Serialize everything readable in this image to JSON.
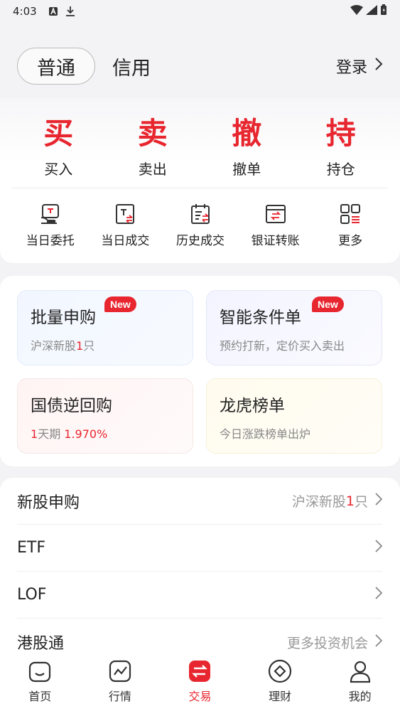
{
  "status_bar": {
    "time": "4:03"
  },
  "header": {
    "mode_active": "普通",
    "mode_other": "信用",
    "login_label": "登录"
  },
  "main_actions": [
    {
      "glyph": "买",
      "label": "买入"
    },
    {
      "glyph": "卖",
      "label": "卖出"
    },
    {
      "glyph": "撤",
      "label": "撤单"
    },
    {
      "glyph": "持",
      "label": "持仓"
    }
  ],
  "quick_actions": [
    {
      "label": "当日委托",
      "icon": "tablet-hand-icon"
    },
    {
      "label": "当日成交",
      "icon": "trade-doc-icon"
    },
    {
      "label": "历史成交",
      "icon": "calendar-list-icon"
    },
    {
      "label": "银证转账",
      "icon": "transfer-card-icon"
    },
    {
      "label": "更多",
      "icon": "grid-icon"
    }
  ],
  "features": [
    {
      "title": "批量申购",
      "sub_prefix": "沪深新股",
      "sub_highlight": "1",
      "sub_suffix": "只",
      "badge": "New"
    },
    {
      "title": "智能条件单",
      "sub": "预约打新，定价买入卖出",
      "badge": "New"
    },
    {
      "title": "国债逆回购",
      "sub_highlight": "1",
      "sub_mid": "天期 ",
      "sub_rate": "1.970%"
    },
    {
      "title": "龙虎榜单",
      "sub": "今日涨跌榜单出炉"
    }
  ],
  "list_rows": [
    {
      "title": "新股申购",
      "right_prefix": "沪深新股",
      "right_highlight": "1",
      "right_suffix": "只"
    },
    {
      "title": "ETF"
    },
    {
      "title": "LOF"
    },
    {
      "title": "港股通",
      "right_text": "更多投资机会"
    }
  ],
  "tabs": [
    {
      "label": "首页",
      "icon": "home-icon"
    },
    {
      "label": "行情",
      "icon": "chart-icon"
    },
    {
      "label": "交易",
      "icon": "swap-icon",
      "active": true
    },
    {
      "label": "理财",
      "icon": "diamond-icon"
    },
    {
      "label": "我的",
      "icon": "user-icon"
    }
  ],
  "colors": {
    "accent": "#e8262f",
    "text": "#222222",
    "muted": "#888888"
  }
}
